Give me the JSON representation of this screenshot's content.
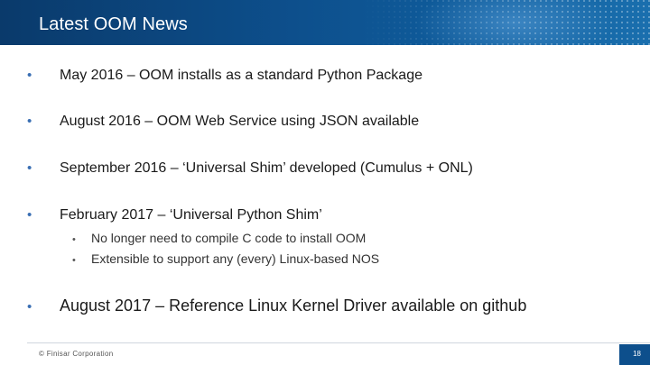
{
  "slide": {
    "title": "Latest OOM News"
  },
  "bullets": [
    {
      "text": "May 2016 – OOM installs as a standard Python Package"
    },
    {
      "text": "August 2016 – OOM Web Service using JSON available"
    },
    {
      "text": "September 2016 – ‘Universal Shim’ developed (Cumulus + ONL)"
    },
    {
      "text": "February 2017 – ‘Universal Python Shim’",
      "subitems": [
        "No longer need to compile C code to install OOM",
        "Extensible to support any (every) Linux-based NOS"
      ]
    },
    {
      "text": "August 2017 – Reference Linux Kernel Driver available on github"
    }
  ],
  "footer": {
    "copyright": "© Finisar Corporation",
    "page_number": "18"
  },
  "colors": {
    "header_bg": "#0d4f8c",
    "bullet": "#3a6fb3"
  }
}
